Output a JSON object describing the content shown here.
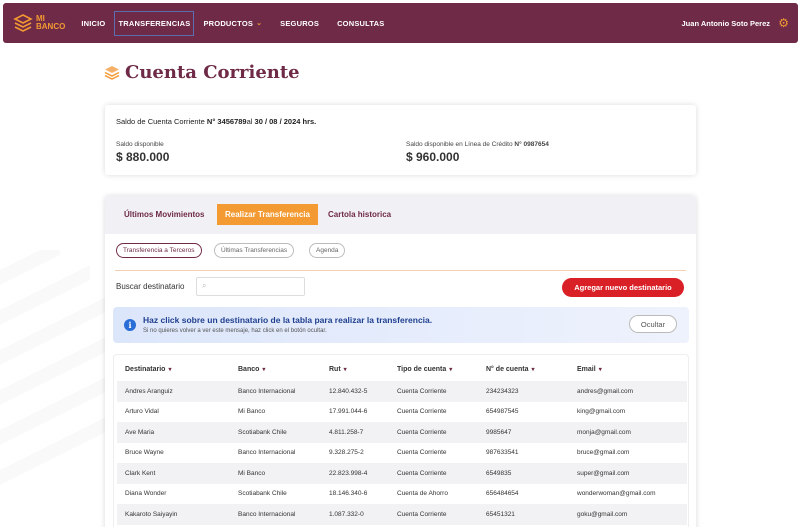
{
  "nav": {
    "logo_line1": "MI",
    "logo_line2": "BANCO",
    "items": [
      {
        "label": "INICIO"
      },
      {
        "label": "TRANSFERENCIAS"
      },
      {
        "label": "PRODUCTOS"
      },
      {
        "label": "SEGUROS"
      },
      {
        "label": "CONSULTAS"
      }
    ],
    "user": "Juan Antonio Soto Perez"
  },
  "page_title": "Cuenta Corriente",
  "balance": {
    "line_prefix": "Saldo de Cuenta Corriente",
    "account": "N° 3456789",
    "line_mid": "al",
    "date": "30 / 08 / 2024 hrs.",
    "available_label": "Saldo disponible",
    "available_amount": "$ 880.000",
    "credit_label": "Saldo disponible en Línea de Crédito",
    "credit_account": "N° 0987654",
    "credit_amount": "$ 960.000"
  },
  "tabs": [
    "Últimos Movimientos",
    "Realizar Transferencia",
    "Cartola historica"
  ],
  "pills": [
    "Transferencia a Terceros",
    "Últimas Transferencias",
    "Agenda"
  ],
  "search": {
    "label": "Buscar destinatario",
    "placeholder": ""
  },
  "add_button": "Agregar nuevo destinatario",
  "info": {
    "title": "Haz click sobre un destinatario de la tabla para realizar la transferencia.",
    "subtitle": "Si no quieres volver a ver este mensaje, haz click en el botón ocultar.",
    "hide_button": "Ocultar"
  },
  "table": {
    "headers": [
      "Destinatario",
      "Banco",
      "Rut",
      "Tipo de cuenta",
      "N° de cuenta",
      "Email"
    ],
    "rows": [
      [
        "Andres Aranguiz",
        "Banco Internacional",
        "12.840.432-5",
        "Cuenta Corriente",
        "234234323",
        "andres@gmail.com"
      ],
      [
        "Arturo Vidal",
        "Mi Banco",
        "17.991.044-6",
        "Cuenta Corriente",
        "654987545",
        "king@gmail.com"
      ],
      [
        "Ave Maria",
        "Scotiabank Chile",
        "4.811.258-7",
        "Cuenta Corriente",
        "9985647",
        "monja@gmail.com"
      ],
      [
        "Bruce Wayne",
        "Banco Internacional",
        "9.328.275-2",
        "Cuenta Corriente",
        "987633541",
        "bruce@gmail.com"
      ],
      [
        "Clark Kent",
        "Mi Banco",
        "22.823.998-4",
        "Cuenta Corriente",
        "6549835",
        "super@gmail.com"
      ],
      [
        "Diana Wonder",
        "Scotiabank Chile",
        "18.146.340-6",
        "Cuenta de Ahorro",
        "656484654",
        "wonderwoman@gmail.com"
      ],
      [
        "Kakaroto Saiyayin",
        "Banco Internacional",
        "1.087.332-0",
        "Cuenta Corriente",
        "65451321",
        "goku@gmail.com"
      ]
    ]
  },
  "colors": {
    "primary": "#6e2a46",
    "accent": "#f39a33",
    "danger": "#d92027",
    "info": "#2a6dd6"
  }
}
